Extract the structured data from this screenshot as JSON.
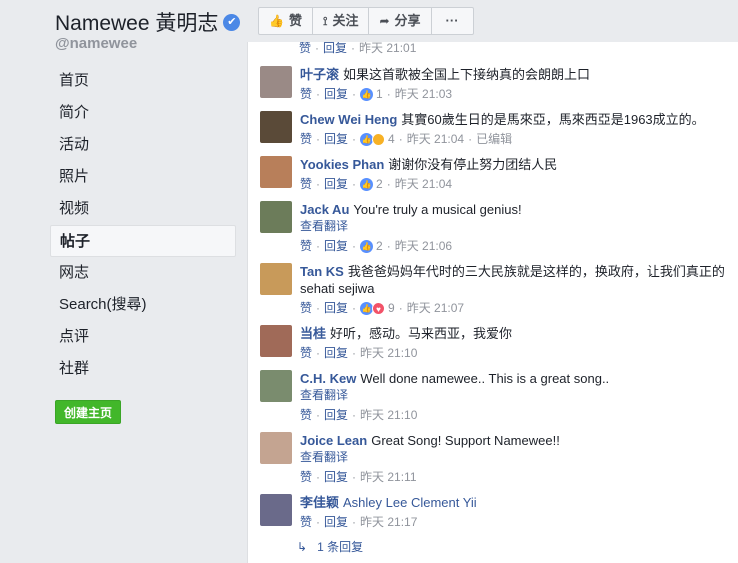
{
  "page": {
    "name": "Namewee 黃明志",
    "handle": "@namewee",
    "verified_mark": "✔",
    "create_label": "创建主页"
  },
  "nav": [
    "首页",
    "简介",
    "活动",
    "照片",
    "视频",
    "帖子",
    "网志",
    "Search(搜尋)",
    "点评",
    "社群"
  ],
  "actions": {
    "like": "赞",
    "follow": "关注",
    "share": "分享",
    "more": "···"
  },
  "colors": {
    "link": "#365899",
    "accent": "#42b72a",
    "like_blue": "#5890ff",
    "heart": "#f25268",
    "haha": "#f7b125"
  },
  "labels": {
    "like": "赞",
    "reply": "回复",
    "translate": "查看翻译",
    "edited": "已编辑",
    "sep": "·"
  },
  "top_partial": {
    "time": "昨天 21:01"
  },
  "comments": [
    {
      "author": "叶子滚",
      "text": "如果这首歌被全国上下接纳真的会朗朗上口",
      "reactions": "1",
      "time": "昨天 21:03",
      "avatar_color": "#9a8a86"
    },
    {
      "author": "Chew Wei Heng",
      "text": "其實60歲生日的是馬來亞，馬來西亞是1963成立的。",
      "reactions": "4",
      "time": "昨天 21:04",
      "edited": true,
      "avatar_color": "#5a4a38"
    },
    {
      "author": "Yookies Phan",
      "text": "谢谢你没有停止努力团结人民",
      "reactions": "2",
      "time": "昨天 21:04",
      "avatar_color": "#b87f5a"
    },
    {
      "author": "Jack Au",
      "text": "You're truly a musical genius!",
      "reactions": "2",
      "time": "昨天 21:06",
      "translate": true,
      "avatar_color": "#6c7c5a"
    },
    {
      "author": "Tan KS",
      "text": "我爸爸妈妈年代时的三大民族就是这样的，换政府，让我们真正的sehati sejiwa",
      "reactions": "9",
      "time": "昨天 21:07",
      "avatar_color": "#c89a5a"
    },
    {
      "author": "当桂",
      "text": "好听，感动。马来西亚，我爱你",
      "time": "昨天 21:10",
      "avatar_color": "#a06a58"
    },
    {
      "author": "C.H. Kew",
      "text": "Well done namewee.. This is a great song..",
      "time": "昨天 21:10",
      "translate": true,
      "avatar_color": "#7a8c6e"
    },
    {
      "author": "Joice Lean",
      "text": "Great Song! Support Namewee!!",
      "time": "昨天 21:11",
      "translate": true,
      "avatar_color": "#c4a491"
    },
    {
      "author": "李佳颖",
      "author_tag": "Ashley Lee Clement Yii",
      "text": "",
      "time": "昨天 21:17",
      "avatar_color": "#6a6a8a"
    }
  ],
  "reply_link": "1 条回复"
}
